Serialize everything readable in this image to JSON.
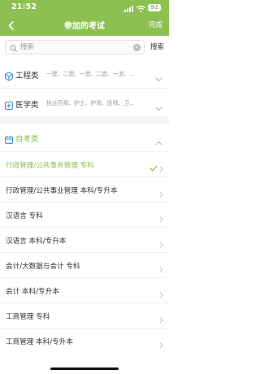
{
  "status_bar": {
    "time": "21:52",
    "battery": "92"
  },
  "nav": {
    "title": "参加的考试",
    "done_label": "完成"
  },
  "search": {
    "placeholder": "搜索",
    "value": "",
    "button_label": "搜索"
  },
  "categories": [
    {
      "name": "工程类",
      "subtitle": "一建、二建、一造、二造、一消、...",
      "icon": "cube-icon",
      "expanded": false
    },
    {
      "name": "医学类",
      "subtitle": "执业药师、护士、护师、医师、卫...",
      "icon": "medical-cross-icon",
      "expanded": false
    },
    {
      "name": "自考类",
      "subtitle": "",
      "icon": "calendar-icon",
      "expanded": true
    }
  ],
  "exam_items": [
    {
      "label": "行政管理/公共事务管理 专科",
      "selected": true
    },
    {
      "label": "行政管理/公共事业管理 本科/专升本",
      "selected": false
    },
    {
      "label": "汉语言 专科",
      "selected": false
    },
    {
      "label": "汉语言 本科/专升本",
      "selected": false
    },
    {
      "label": "会计/大数据与会计 专科",
      "selected": false
    },
    {
      "label": "会计 本科/专升本",
      "selected": false
    },
    {
      "label": "工商管理 专科",
      "selected": false
    },
    {
      "label": "工商管理 本科/专升本",
      "selected": false
    }
  ],
  "colors": {
    "accent": "#8cc152",
    "icon_blue": "#3b8fe0",
    "text": "#333333",
    "muted": "#999999"
  }
}
